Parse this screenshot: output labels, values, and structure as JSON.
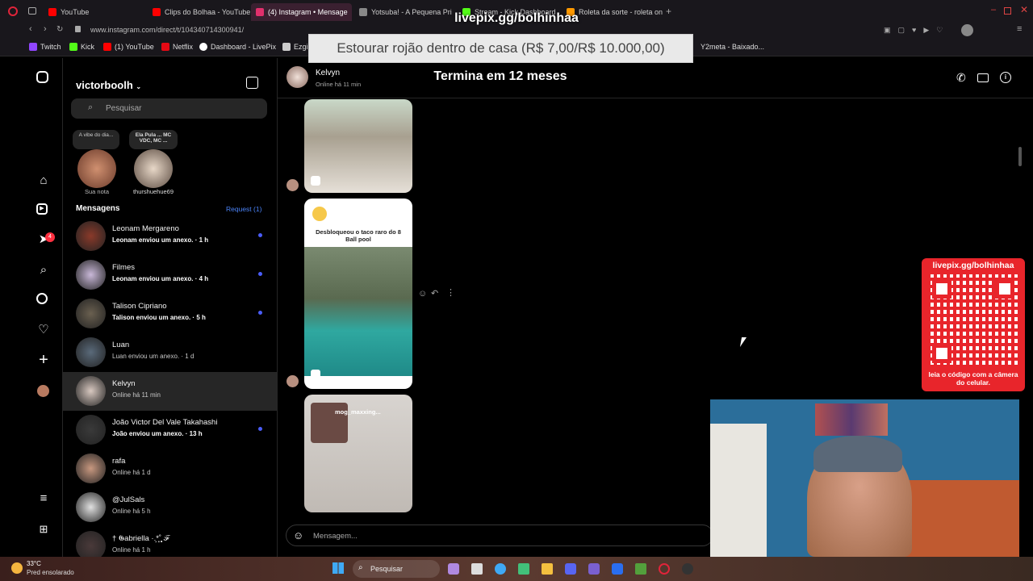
{
  "browser": {
    "tabs": [
      {
        "label": "YouTube",
        "color": "#ff0000"
      },
      {
        "label": "Clips do Bolhaa - YouTube",
        "color": "#ff0000"
      },
      {
        "label": "(4) Instagram • Mensage",
        "color": "#e1306c"
      },
      {
        "label": "Yotsuba! - A Pequena Pri",
        "color": "#888888"
      },
      {
        "label": "Stream - Kick Dashboard",
        "color": "#53fc18"
      },
      {
        "label": "Roleta da sorte - roleta on",
        "color": "#ff9900"
      }
    ],
    "url": "www.instagram.com/direct/t/104340714300941/",
    "bookmarks": [
      {
        "label": "Twitch",
        "color": "#9146ff"
      },
      {
        "label": "Kick",
        "color": "#53fc18"
      },
      {
        "label": "(1) YouTube",
        "color": "#ff0000"
      },
      {
        "label": "Netflix",
        "color": "#e50914"
      },
      {
        "label": "Dashboard - LivePix",
        "color": "#ffffff"
      },
      {
        "label": "Ezgi",
        "color": "#cccccc"
      },
      {
        "label": "Y2meta - Baixado...",
        "color": "#cccccc"
      }
    ]
  },
  "overlay": {
    "stream_url": "livepix.gg/bolhinhaa",
    "donation_goal": "Estourar rojão dentro de casa (R$ 7,00/R$ 10.000,00)",
    "ends_in": "Termina em 12 meses",
    "qr_top": "livepix.gg/bolhinhaa",
    "qr_bottom": "leia o código com a câmera do celular."
  },
  "inbox": {
    "username": "victorboolh",
    "search_placeholder": "Pesquisar",
    "notes": [
      {
        "note": "A vibe do dia...",
        "name": "Sua nota"
      },
      {
        "note": "Ela Pula ... MC VDC, MC ...",
        "name": "thurshuehue69"
      }
    ],
    "messages_heading": "Mensagens",
    "request_label": "Request (1)",
    "notification_count": "4",
    "conversations": [
      {
        "name": "Leonam Mergareno",
        "preview": "Leonam enviou um anexo. · 1 h",
        "unread": true,
        "avatar": "#8a3a2a"
      },
      {
        "name": "Filmes",
        "preview": "Leonam enviou um anexo. · 4 h",
        "unread": true,
        "avatar": "#c9b8d8"
      },
      {
        "name": "Talison Cipriano",
        "preview": "Talison enviou um anexo. · 5 h",
        "unread": true,
        "avatar": "#6a6050"
      },
      {
        "name": "Luan",
        "preview": "Luan enviou um anexo. · 1 d",
        "unread": false,
        "avatar": "#5a6a7a"
      },
      {
        "name": "Kelvyn",
        "preview": "Online há 11 min",
        "unread": false,
        "avatar": "#d8c8c0",
        "selected": true
      },
      {
        "name": "João Victor Del Vale Takahashi",
        "preview": "João enviou um anexo. · 13 h",
        "unread": true,
        "avatar": "#3a3a3a"
      },
      {
        "name": "rafa",
        "preview": "Online há 1 d",
        "unread": false,
        "avatar": "#c89880"
      },
      {
        "name": "@JulSals",
        "preview": "Online há 5 h",
        "unread": false,
        "avatar": "#e0e0e0"
      },
      {
        "name": "† 𝕲abriella ·.͙*̩̩͙˚̩̥̩̥ ℱ",
        "preview": "Online há 1 h",
        "unread": false,
        "avatar": "#4a3a3a"
      }
    ]
  },
  "chat": {
    "contact_name": "Kelvyn",
    "contact_status": "Online há 11 min",
    "media": [
      {
        "caption": ""
      },
      {
        "caption": "Desbloqueou o taco raro do 8 Ball pool"
      },
      {
        "caption": "mog_maxxing..."
      }
    ],
    "composer_placeholder": "Mensagem..."
  },
  "taskbar": {
    "weather_temp": "33°C",
    "weather_desc": "Pred ensolarado",
    "search": "Pesquisar"
  }
}
